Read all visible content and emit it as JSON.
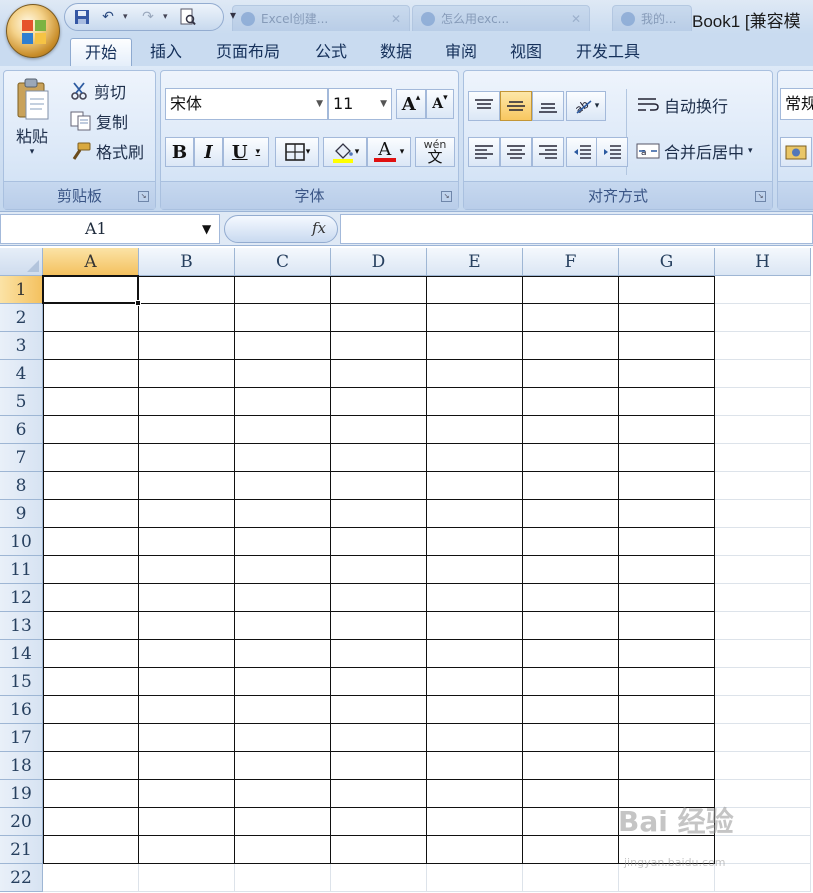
{
  "window": {
    "title": "Book1  [兼容模",
    "background_tabs": [
      "Excel创建...",
      "怎么用exc...",
      "我的..."
    ]
  },
  "ribbon_tabs": [
    "开始",
    "插入",
    "页面布局",
    "公式",
    "数据",
    "审阅",
    "视图",
    "开发工具"
  ],
  "active_tab": "开始",
  "clipboard": {
    "paste": "粘贴",
    "cut": "剪切",
    "copy": "复制",
    "format_painter": "格式刷",
    "label": "剪贴板"
  },
  "font": {
    "name": "宋体",
    "size": "11",
    "label": "字体",
    "bold": "B",
    "italic": "I",
    "underline": "U",
    "grow": "A",
    "shrink": "A",
    "font_color_letter": "A",
    "phonetic": "wén"
  },
  "alignment": {
    "wrap_text": "自动换行",
    "merge_center": "合并后居中",
    "label": "对齐方式"
  },
  "number": {
    "format": "常规"
  },
  "formula_bar": {
    "name_box": "A1",
    "fx": "fx",
    "content": ""
  },
  "grid": {
    "columns": [
      "A",
      "B",
      "C",
      "D",
      "E",
      "F",
      "G",
      "H"
    ],
    "rows": [
      "1",
      "2",
      "3",
      "4",
      "5",
      "6",
      "7",
      "8",
      "9",
      "10",
      "11",
      "12",
      "13",
      "14",
      "15",
      "16",
      "17",
      "18",
      "19",
      "20",
      "21",
      "22"
    ],
    "selected_cell": "A1",
    "bordered_range": "A1:G21"
  },
  "watermark": {
    "text": "Bai 经验",
    "sub": "jingyan.baidu.com"
  },
  "colors": {
    "ribbon_bg": "#cfdff2",
    "selected_header": "#f4c15f",
    "highlight_fill": "#ffff00",
    "font_color": "#e01010"
  }
}
